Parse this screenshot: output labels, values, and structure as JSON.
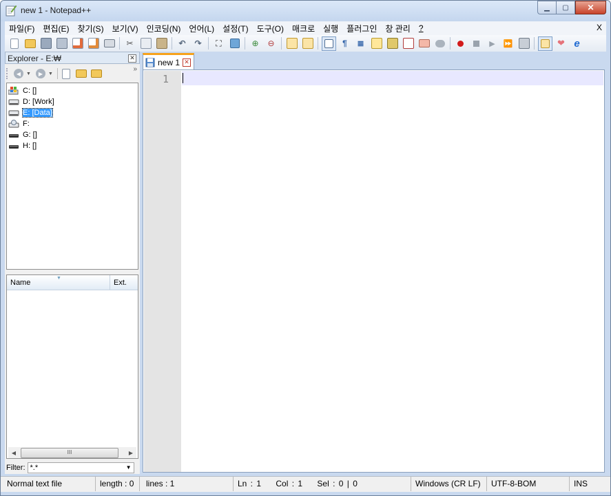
{
  "window": {
    "title": "new 1 - Notepad++"
  },
  "menu": [
    "파일(F)",
    "편집(E)",
    "찾기(S)",
    "보기(V)",
    "인코딩(N)",
    "언어(L)",
    "설정(T)",
    "도구(O)",
    "매크로",
    "실행",
    "플러그인",
    "창 관리",
    "?"
  ],
  "menu_close": "X",
  "explorer": {
    "title": "Explorer - E:₩",
    "drives": [
      {
        "label": "C: []"
      },
      {
        "label": "D: [Work]"
      },
      {
        "label": "E: [Data]"
      },
      {
        "label": "F:"
      },
      {
        "label": "G: []"
      },
      {
        "label": "H: []"
      }
    ],
    "columns": {
      "name": "Name",
      "ext": "Ext."
    },
    "scroll_grip": "III",
    "filter_label": "Filter:",
    "filter_value": "*.*"
  },
  "tab": {
    "label": "new 1"
  },
  "editor": {
    "line_number": "1"
  },
  "status": {
    "file_type": "Normal text file",
    "length": "length : 0",
    "lines": "lines : 1",
    "ln": "Ln : 1",
    "col": "Col : 1",
    "sel": "Sel : 0 | 0",
    "eol": "Windows (CR LF)",
    "encoding": "UTF-8-BOM",
    "mode": "INS"
  },
  "colors": {
    "accent_tab": "#f7a21b",
    "selection": "#3399ff",
    "current_line": "#e8e8ff",
    "frame": "#c9d9ef"
  }
}
